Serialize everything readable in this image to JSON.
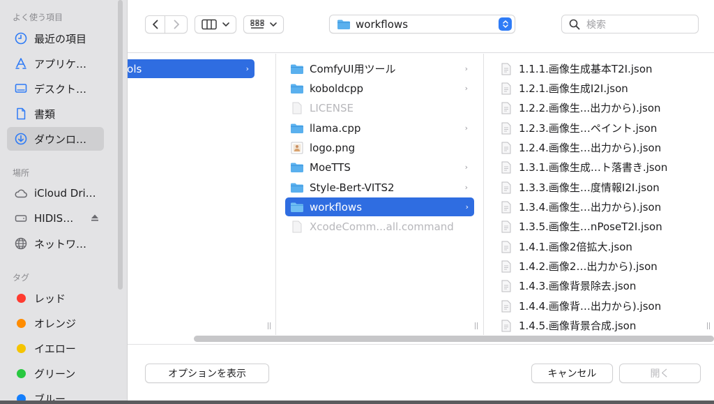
{
  "sidebar": {
    "sections": [
      {
        "title": "よく使う項目",
        "items": [
          {
            "label": "最近の項目",
            "icon": "clock-icon"
          },
          {
            "label": "アプリケ…",
            "icon": "applications-icon"
          },
          {
            "label": "デスクト…",
            "icon": "desktop-icon"
          },
          {
            "label": "書類",
            "icon": "document-icon"
          },
          {
            "label": "ダウンロ…",
            "icon": "download-icon",
            "selected": true
          }
        ]
      },
      {
        "title": "場所",
        "items": [
          {
            "label": "iCloud Dri…",
            "icon": "cloud-icon"
          },
          {
            "label": "HIDIS…",
            "icon": "drive-icon"
          },
          {
            "label": "ネットワ…",
            "icon": "network-icon"
          }
        ]
      },
      {
        "title": "タグ",
        "items": [
          {
            "label": "レッド",
            "color": "#ff3b30"
          },
          {
            "label": "オレンジ",
            "color": "#ff8c00"
          },
          {
            "label": "イエロー",
            "color": "#f5c400"
          },
          {
            "label": "グリーン",
            "color": "#28c840"
          },
          {
            "label": "ブルー",
            "color": "#147efb"
          }
        ]
      }
    ]
  },
  "toolbar": {
    "back_icon": "chevron-left-icon",
    "forward_icon": "chevron-right-icon",
    "view_icon": "columns-view-icon",
    "group_icon": "grid-group-icon",
    "path": "workflows",
    "search_placeholder": "検索"
  },
  "columns": {
    "col1": [
      {
        "name": "ools",
        "selected": true,
        "chevron": true
      }
    ],
    "col2": [
      {
        "name": "ComfyUI用ツール",
        "type": "folder",
        "chevron": true
      },
      {
        "name": "koboldcpp",
        "type": "folder",
        "chevron": true
      },
      {
        "name": "LICENSE",
        "type": "file",
        "dim": true
      },
      {
        "name": "llama.cpp",
        "type": "folder",
        "chevron": true
      },
      {
        "name": "logo.png",
        "type": "image"
      },
      {
        "name": "MoeTTS",
        "type": "folder",
        "chevron": true
      },
      {
        "name": "Style-Bert-VITS2",
        "type": "folder",
        "chevron": true
      },
      {
        "name": "workflows",
        "type": "folder",
        "chevron": true,
        "selected": true
      },
      {
        "name": "XcodeComm...all.command",
        "type": "file",
        "dim": true
      }
    ],
    "col3": [
      "1.1.1.画像生成基本T2I.json",
      "1.2.1.画像生成I2I.json",
      "1.2.2.画像生...出力から).json",
      "1.2.3.画像生…ペイント.json",
      "1.2.4.画像生…出力から).json",
      "1.3.1.画像生成…ト落書き.json",
      "1.3.3.画像生…度情報I2I.json",
      "1.3.4.画像生…出力から).json",
      "1.3.5.画像生…nPoseT2I.json",
      "1.4.1.画像2倍拡大.json",
      "1.4.2.画像2…出力から).json",
      "1.4.3.画像背景除去.json",
      "1.4.4.画像背…出力から).json",
      "1.4.5.画像背景合成.json"
    ]
  },
  "buttons": {
    "options": "オプションを表示",
    "cancel": "キャンセル",
    "open": "開く"
  },
  "colors": {
    "accent": "#2f6de1",
    "folder": "#5ab0ee"
  }
}
